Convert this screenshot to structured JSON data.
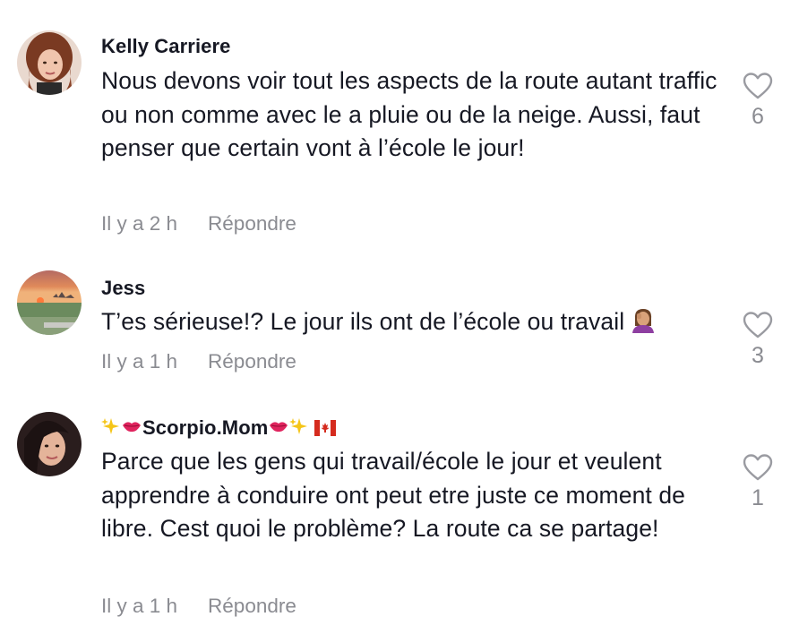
{
  "comments": [
    {
      "author": "Kelly Carriere",
      "text": "Nous devons voir tout les aspects de la route autant traffic ou non comme avec le a pluie ou de la neige. Aussi, faut penser que certain vont à l’école le jour!",
      "time": "Il y a 2 h",
      "reply_label": "Répondre",
      "likes": "6"
    },
    {
      "author": "Jess",
      "text": "T’es sérieuse!? Le jour ils ont de l’école ou travail",
      "time": "Il y a 1 h",
      "reply_label": "Répondre",
      "likes": "3"
    },
    {
      "author": "Scorpio.Mom",
      "text": "Parce que les gens qui travail/école le jour et veulent apprendre à conduire ont peut etre juste ce moment de libre. Cest quoi le problème? La route ca se partage!",
      "time": "Il y a 1 h",
      "reply_label": "Répondre",
      "likes": "1"
    }
  ],
  "icons": {
    "like": "heart-outline-icon",
    "jess_emoji": "woman-facepalming-emoji",
    "scorpio_name_decor": [
      "sparkles-emoji",
      "kiss-mark-emoji",
      "canada-flag-emoji"
    ]
  },
  "colors": {
    "text": "#161823",
    "muted": "#8a8b91",
    "background": "#ffffff"
  }
}
